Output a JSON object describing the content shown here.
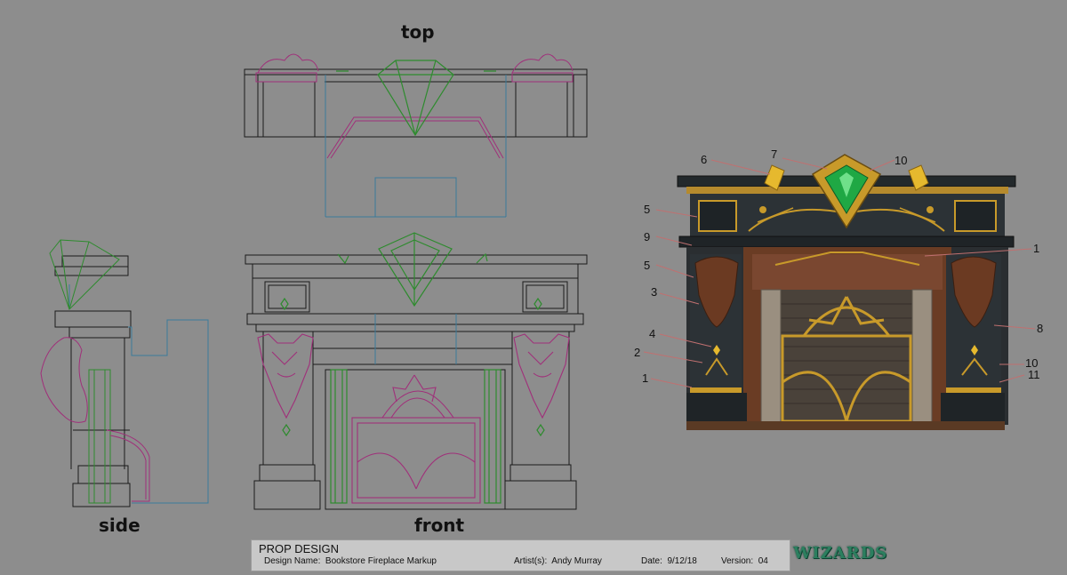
{
  "views": {
    "top": "top",
    "side": "side",
    "front": "front"
  },
  "callouts": [
    "6",
    "7",
    "10",
    "5",
    "9",
    "5",
    "3",
    "4",
    "2",
    "1",
    "1",
    "8",
    "10",
    "11"
  ],
  "title_block": {
    "heading": "PROP DESIGN",
    "design_name_label": "Design Name:",
    "design_name": "Bookstore Fireplace Markup",
    "artist_label": "Artist(s):",
    "artist": "Andy Murray",
    "date_label": "Date:",
    "date": "9/12/18",
    "version_label": "Version:",
    "version": "04"
  },
  "logo_text": "WIZARDS",
  "colors": {
    "background": "#8d8d8d",
    "line_black": "#1a1a1a",
    "line_green": "#2e8b2e",
    "line_magenta": "#a0307a",
    "line_blue": "#3a7a9a",
    "gold": "#c89a2a",
    "emerald": "#1fa844",
    "marble": "#2c3236"
  }
}
